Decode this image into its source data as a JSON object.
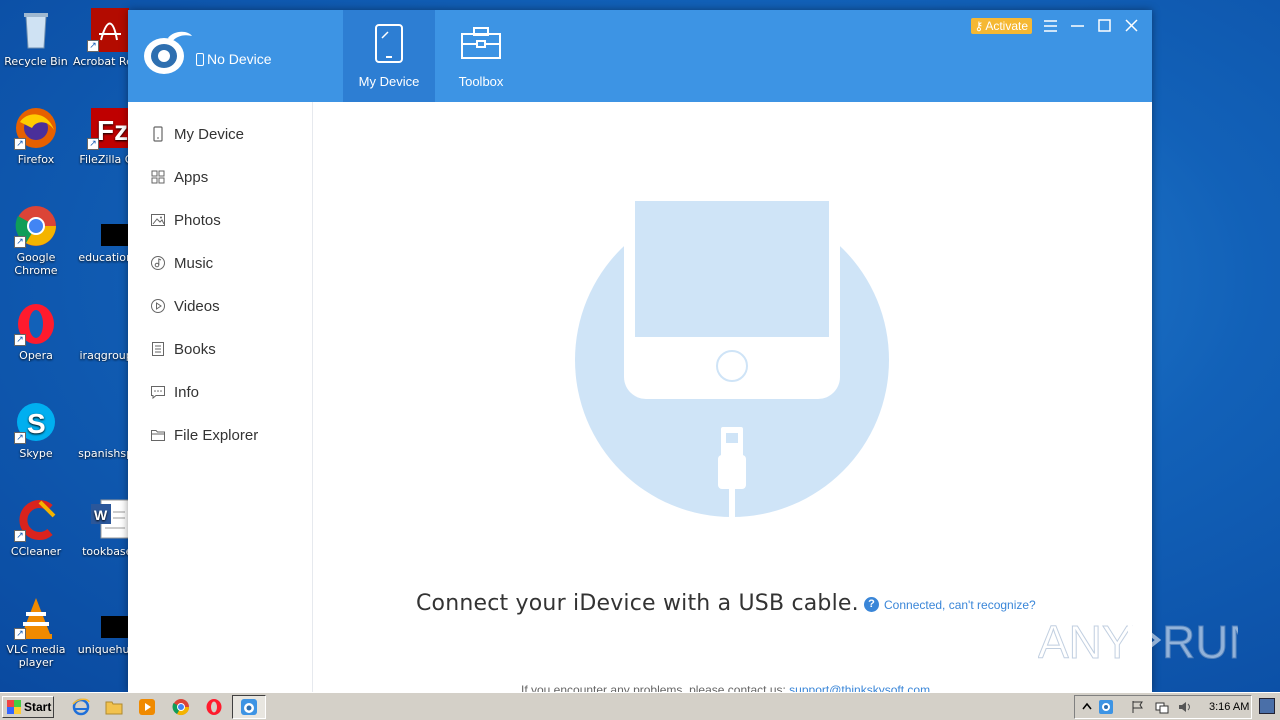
{
  "desktop": {
    "icons": [
      {
        "label": "Recycle Bin"
      },
      {
        "label": "Acrobat Reader D"
      },
      {
        "label": "Firefox"
      },
      {
        "label": "FileZilla Cli"
      },
      {
        "label": "Google Chrome"
      },
      {
        "label": "educationa"
      },
      {
        "label": "Opera"
      },
      {
        "label": "iraqgroups"
      },
      {
        "label": "Skype"
      },
      {
        "label": "spanishspe"
      },
      {
        "label": "CCleaner"
      },
      {
        "label": "tookbase."
      },
      {
        "label": "VLC media player"
      },
      {
        "label": "uniquehum"
      }
    ]
  },
  "app": {
    "device_status": "No Device",
    "activate_label": "Activate",
    "tabs": [
      {
        "label": "My Device",
        "icon": "tablet-icon",
        "active": true
      },
      {
        "label": "Toolbox",
        "icon": "toolbox-icon",
        "active": false
      }
    ],
    "sidebar": {
      "items": [
        {
          "label": "My Device",
          "icon": "phone-icon"
        },
        {
          "label": "Apps",
          "icon": "apps-grid-icon"
        },
        {
          "label": "Photos",
          "icon": "image-icon"
        },
        {
          "label": "Music",
          "icon": "music-icon"
        },
        {
          "label": "Videos",
          "icon": "play-icon"
        },
        {
          "label": "Books",
          "icon": "book-icon"
        },
        {
          "label": "Info",
          "icon": "message-icon"
        },
        {
          "label": "File Explorer",
          "icon": "folder-icon"
        }
      ]
    },
    "main": {
      "connect_message": "Connect your iDevice with a USB cable.",
      "help_link": "Connected, can't recognize?",
      "contact_text": "If you encounter any problems, please contact us:",
      "contact_email": "support@thinkskysoft.com"
    }
  },
  "watermark": "ANY RUN",
  "taskbar": {
    "start_label": "Start",
    "clock": "3:16 AM"
  },
  "colors": {
    "header_blue": "#3d94e4",
    "active_tab": "#2d7ed3",
    "link_blue": "#3a86d8",
    "activate_orange": "#f5b833",
    "illustration_blue": "#cfe4f7"
  }
}
